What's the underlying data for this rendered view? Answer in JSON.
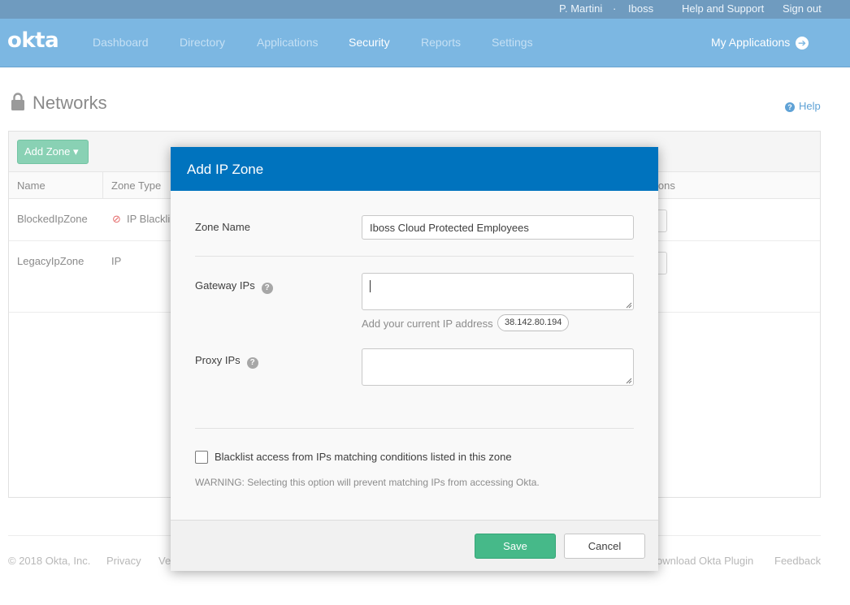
{
  "topbar": {
    "user": "P. Martini",
    "separator": "·",
    "org": "Iboss",
    "help_support": "Help and Support",
    "sign_out": "Sign out"
  },
  "nav": {
    "logo": "okta",
    "items": [
      "Dashboard",
      "Directory",
      "Applications",
      "Security",
      "Reports",
      "Settings"
    ],
    "active": "Security",
    "my_apps": "My Applications"
  },
  "page": {
    "title": "Networks",
    "help": "Help",
    "add_zone": "Add Zone ▾",
    "columns": [
      "Name",
      "Zone Type",
      "ions"
    ],
    "rows": [
      {
        "name": "BlockedIpZone",
        "type": "IP Blackli"
      },
      {
        "name": "LegacyIpZone",
        "type": "IP"
      }
    ]
  },
  "footer": {
    "copyright": "© 2018 Okta, Inc.",
    "privacy": "Privacy",
    "version": "Ve",
    "download": "ownload Okta Plugin",
    "feedback": "Feedback"
  },
  "modal": {
    "title": "Add IP Zone",
    "zone_name_label": "Zone Name",
    "zone_name_value": "Iboss Cloud Protected Employees",
    "gateway_label": "Gateway IPs",
    "gateway_value": "",
    "current_ip_hint": "Add your current IP address",
    "current_ip": "38.142.80.194",
    "proxy_label": "Proxy IPs",
    "proxy_value": "",
    "help_glyph": "?",
    "blacklist_label": "Blacklist access from IPs matching conditions listed in this zone",
    "blacklist_checked": false,
    "warning": "WARNING: Selecting this option will prevent matching IPs from accessing Okta.",
    "save": "Save",
    "cancel": "Cancel"
  },
  "colors": {
    "topbar": "#6f9bbf",
    "navbar": "#7cb7e2",
    "modal_header": "#0073be",
    "save_button": "#46b989",
    "add_zone_button": "#89d1b4"
  }
}
